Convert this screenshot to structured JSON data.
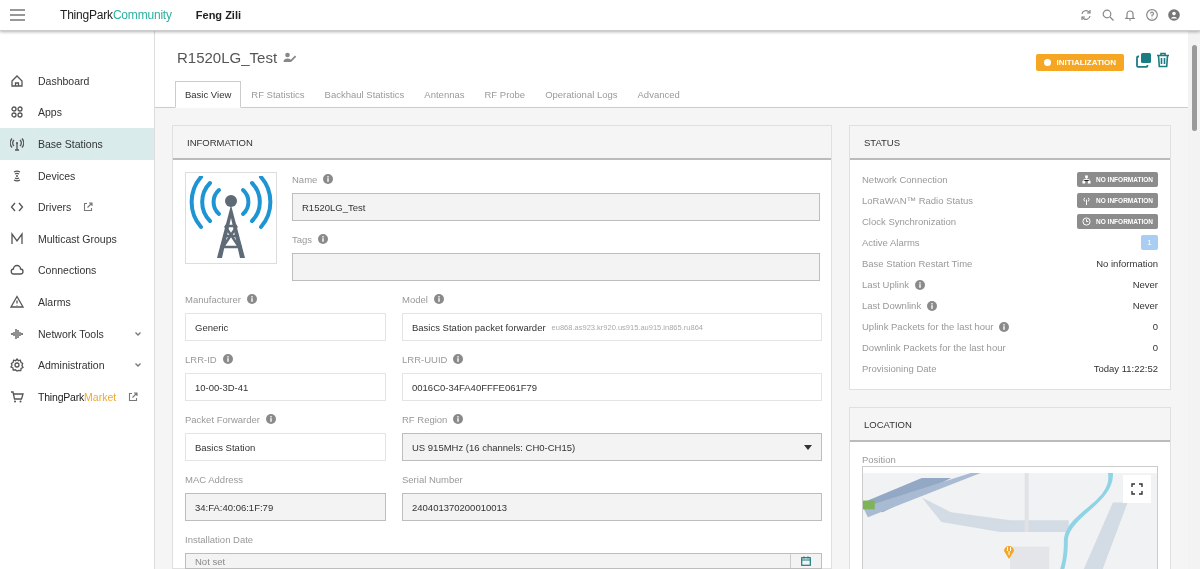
{
  "header": {
    "brand": "ThingPark",
    "brand_suffix": "Community",
    "user": "Feng Zili"
  },
  "sidebar": {
    "items": [
      {
        "label": "Dashboard",
        "selected": false
      },
      {
        "label": "Apps",
        "selected": false
      },
      {
        "label": "Base Stations",
        "selected": true
      },
      {
        "label": "Devices",
        "selected": false
      },
      {
        "label": "Drivers",
        "selected": false,
        "external": true
      },
      {
        "label": "Multicast Groups",
        "selected": false
      },
      {
        "label": "Connections",
        "selected": false
      },
      {
        "label": "Alarms",
        "selected": false
      },
      {
        "label": "Network Tools",
        "selected": false,
        "expandable": true
      },
      {
        "label": "Administration",
        "selected": false,
        "expandable": true
      },
      {
        "label": "ThingPark",
        "label_suffix": "Market",
        "selected": false,
        "external": true
      }
    ]
  },
  "page": {
    "title": "R1520LG_Test",
    "status": "INITIALIZATION",
    "tabs": [
      {
        "label": "Basic View",
        "selected": true,
        "disabled": false
      },
      {
        "label": "RF Statistics",
        "selected": false,
        "disabled": true
      },
      {
        "label": "Backhaul Statistics",
        "selected": false,
        "disabled": true
      },
      {
        "label": "Antennas",
        "selected": false,
        "disabled": true
      },
      {
        "label": "RF Probe",
        "selected": false,
        "disabled": true
      },
      {
        "label": "Operational Logs",
        "selected": false,
        "disabled": true
      },
      {
        "label": "Advanced",
        "selected": false,
        "disabled": true
      }
    ]
  },
  "information": {
    "title": "INFORMATION",
    "top_fields": [
      {
        "label": "Name",
        "info": true,
        "kind": "text",
        "value": "R1520LG_Test",
        "editable": false
      },
      {
        "label": "Tags",
        "info": true,
        "kind": "text",
        "editable": false
      }
    ],
    "fields": [
      {
        "label": "Manufacturer",
        "info": true,
        "kind": "text",
        "value": "Generic",
        "editable": true
      },
      {
        "label": "Model",
        "info": true,
        "kind": "text",
        "value": "Basics Station packet forwarder",
        "hint": "eu868.as923.kr920.us915.au915.in865.ru864",
        "editable": true
      },
      {
        "label": "LRR-ID",
        "info": true,
        "kind": "text",
        "value": "10-00-3D-41",
        "editable": true
      },
      {
        "label": "LRR-UUID",
        "info": true,
        "kind": "text",
        "value": "0016C0-34FA40FFFE061F79",
        "editable": true
      },
      {
        "label": "Packet Forwarder",
        "info": true,
        "kind": "text",
        "value": "Basics Station",
        "editable": true
      },
      {
        "label": "RF Region",
        "info": true,
        "kind": "select",
        "value": "US 915MHz (16 channels: CH0-CH15)",
        "editable": false
      },
      {
        "label": "MAC Address",
        "info": false,
        "kind": "text",
        "value": "34:FA:40:06:1F:79",
        "editable": false
      },
      {
        "label": "Serial Number",
        "info": false,
        "kind": "text",
        "value": "240401370200010013",
        "editable": false
      },
      {
        "label": "Installation Date",
        "info": false,
        "kind": "date",
        "placeholder": "Not set",
        "editable": false
      }
    ]
  },
  "status": {
    "title": "STATUS",
    "rows": [
      {
        "label": "Network Connection",
        "info": false,
        "kind": "badge",
        "value": "NO INFORMATION"
      },
      {
        "label": "LoRaWAN™ Radio Status",
        "info": false,
        "kind": "badge",
        "value": "NO INFORMATION"
      },
      {
        "label": "Clock Synchronization",
        "info": false,
        "kind": "badge",
        "value": "NO INFORMATION"
      },
      {
        "label": "Active Alarms",
        "info": false,
        "kind": "count",
        "value": "1"
      },
      {
        "label": "Base Station Restart Time",
        "info": false,
        "kind": "text",
        "value": "No information"
      },
      {
        "label": "Last Uplink",
        "info": true,
        "kind": "text",
        "value": "Never"
      },
      {
        "label": "Last Downlink",
        "info": true,
        "kind": "text",
        "value": "Never"
      },
      {
        "label": "Uplink Packets for the last hour",
        "info": true,
        "kind": "text",
        "value": "0"
      },
      {
        "label": "Downlink Packets for the last hour",
        "info": false,
        "kind": "text",
        "value": "0"
      },
      {
        "label": "Provisioning Date",
        "info": false,
        "kind": "text",
        "value": "Today 11:22:52"
      }
    ]
  },
  "location": {
    "title": "LOCATION",
    "position_label": "Position"
  }
}
